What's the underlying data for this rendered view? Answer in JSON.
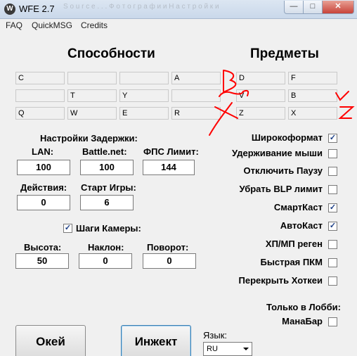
{
  "window": {
    "title": "WFE 2.7",
    "app_icon": "W",
    "min_icon": "—",
    "max_icon": "□",
    "close_icon": "✕",
    "background_tabs": "S o u r c e . . .   Ф о т о г р а ф и и   Н а с т р о й к и"
  },
  "menu": [
    "FAQ",
    "QuickMSG",
    "Credits"
  ],
  "headings": {
    "abilities": "Способности",
    "items": "Предметы"
  },
  "ability_slots": [
    [
      "C",
      "",
      "",
      "A"
    ],
    [
      "",
      "T",
      "Y",
      ""
    ],
    [
      "Q",
      "W",
      "E",
      "R"
    ]
  ],
  "item_slots": [
    [
      "D",
      "F"
    ],
    [
      "V",
      "B"
    ],
    [
      "Z",
      "X"
    ]
  ],
  "delay": {
    "title": "Настройки Задержки:",
    "lan_label": "LAN:",
    "lan_value": "100",
    "bnet_label": "Battle.net:",
    "bnet_value": "100",
    "fps_label": "ФПС Лимит:",
    "fps_value": "144",
    "actions_label": "Действия:",
    "actions_value": "0",
    "start_label": "Старт Игры:",
    "start_value": "6"
  },
  "camera": {
    "checkbox_label": "Шаги Камеры:",
    "checked": true,
    "height_label": "Высота:",
    "height_value": "50",
    "tilt_label": "Наклон:",
    "tilt_value": "0",
    "rotate_label": "Поворот:",
    "rotate_value": "0"
  },
  "options": [
    {
      "label": "Широкоформат",
      "checked": true
    },
    {
      "label": "Удерживание мыши",
      "checked": false
    },
    {
      "label": "Отключить Паузу",
      "checked": false
    },
    {
      "label": "Убрать BLP лимит",
      "checked": false
    },
    {
      "label": "СмартКаст",
      "checked": true
    },
    {
      "label": "АвтоКаст",
      "checked": true
    },
    {
      "label": "ХП/МП реген",
      "checked": false
    },
    {
      "label": "Быстрая ПКМ",
      "checked": false
    },
    {
      "label": "Перекрыть Хоткеи",
      "checked": false
    }
  ],
  "lobby": {
    "title": "Только в Лобби:",
    "manabar_label": "МанаБар",
    "manabar_checked": false
  },
  "buttons": {
    "ok": "Окей",
    "inject": "Инжект"
  },
  "language": {
    "label": "Язык:",
    "value": "RU"
  },
  "annotations": {
    "color": "#ff0000",
    "check_mark": "✓"
  }
}
